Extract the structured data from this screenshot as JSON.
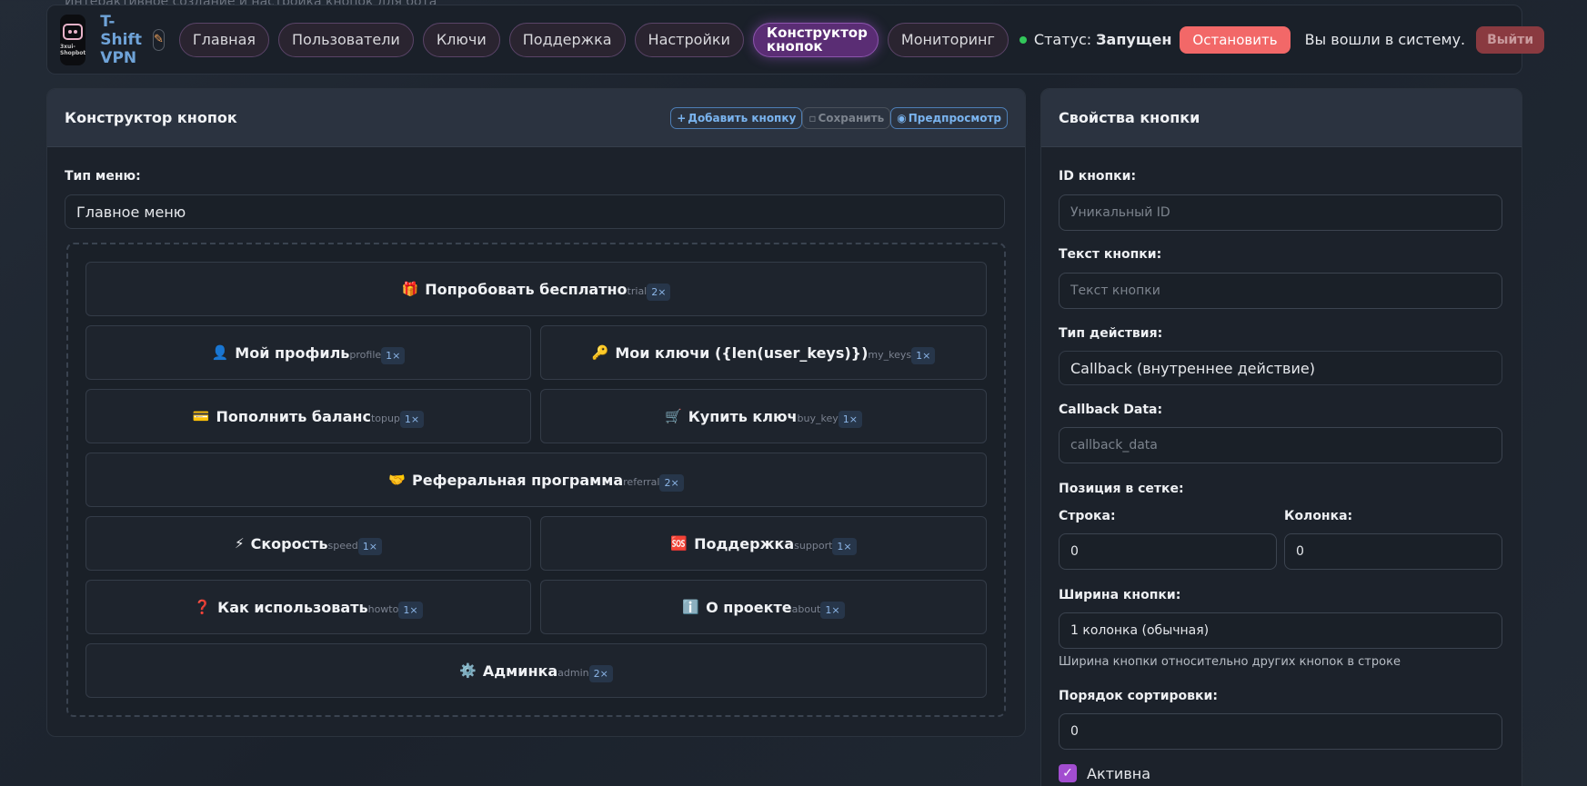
{
  "page": {
    "subtitle": "Интерактивное создание и настройка кнопок для бота"
  },
  "header": {
    "logo_caption": "3xui-Shopbot",
    "brand": "T-Shift VPN",
    "nav": [
      {
        "label": "Главная",
        "active": false
      },
      {
        "label": "Пользователи",
        "active": false
      },
      {
        "label": "Ключи",
        "active": false
      },
      {
        "label": "Поддержка",
        "active": false
      },
      {
        "label": "Настройки",
        "active": false
      },
      {
        "label": "Конструктор кнопок",
        "active": true
      },
      {
        "label": "Мониторинг",
        "active": false
      }
    ],
    "status_label": "Статус:",
    "status_value": "Запущен",
    "stop_label": "Остановить",
    "logged_in": "Вы вошли в систему.",
    "logout_label": "Выйти"
  },
  "builder": {
    "title": "Конструктор кнопок",
    "add_label": "Добавить кнопку",
    "save_label": "Сохранить",
    "preview_label": "Предпросмотр",
    "menu_type_label": "Тип меню:",
    "menu_type_value": "Главное меню",
    "rows": [
      [
        {
          "emoji": "🎁",
          "text": "Попробовать бесплатно",
          "callback": "trial",
          "width": "2×"
        }
      ],
      [
        {
          "emoji": "👤",
          "text": "Мой профиль",
          "callback": "profile",
          "width": "1×"
        },
        {
          "emoji": "🔑",
          "text": "Мои ключи ({len(user_keys)})",
          "callback": "my_keys",
          "width": "1×"
        }
      ],
      [
        {
          "emoji": "💳",
          "text": "Пополнить баланс",
          "callback": "topup",
          "width": "1×"
        },
        {
          "emoji": "🛒",
          "text": "Купить ключ",
          "callback": "buy_key",
          "width": "1×"
        }
      ],
      [
        {
          "emoji": "🤝",
          "text": "Реферальная программа",
          "callback": "referral",
          "width": "2×"
        }
      ],
      [
        {
          "emoji": "⚡",
          "text": "Скорость",
          "callback": "speed",
          "width": "1×"
        },
        {
          "emoji": "🆘",
          "text": "Поддержка",
          "callback": "support",
          "width": "1×"
        }
      ],
      [
        {
          "emoji": "❓",
          "text": "Как использовать",
          "callback": "howto",
          "width": "1×"
        },
        {
          "emoji": "ℹ️",
          "text": "О проекте",
          "callback": "about",
          "width": "1×"
        }
      ],
      [
        {
          "emoji": "⚙️",
          "text": "Админка",
          "callback": "admin",
          "width": "2×"
        }
      ]
    ]
  },
  "properties": {
    "title": "Свойства кнопки",
    "id_label": "ID кнопки:",
    "id_placeholder": "Уникальный ID",
    "text_label": "Текст кнопки:",
    "text_placeholder": "Текст кнопки",
    "action_label": "Тип действия:",
    "action_value": "Callback (внутреннее действие)",
    "callback_label": "Callback Data:",
    "callback_placeholder": "callback_data",
    "grid_label": "Позиция в сетке:",
    "row_label": "Строка:",
    "row_value": "0",
    "col_label": "Колонка:",
    "col_value": "0",
    "width_label": "Ширина кнопки:",
    "width_value": "1 колонка (обычная)",
    "width_hint": "Ширина кнопки относительно других кнопок в строке",
    "sort_label": "Порядок сортировки:",
    "sort_value": "0",
    "active_label": "Активна",
    "active_checked": true
  },
  "colors": {
    "accent": "#5a2d74",
    "stop": "#f26868",
    "status_ok": "#32c75a",
    "link": "#7ab4ef"
  }
}
